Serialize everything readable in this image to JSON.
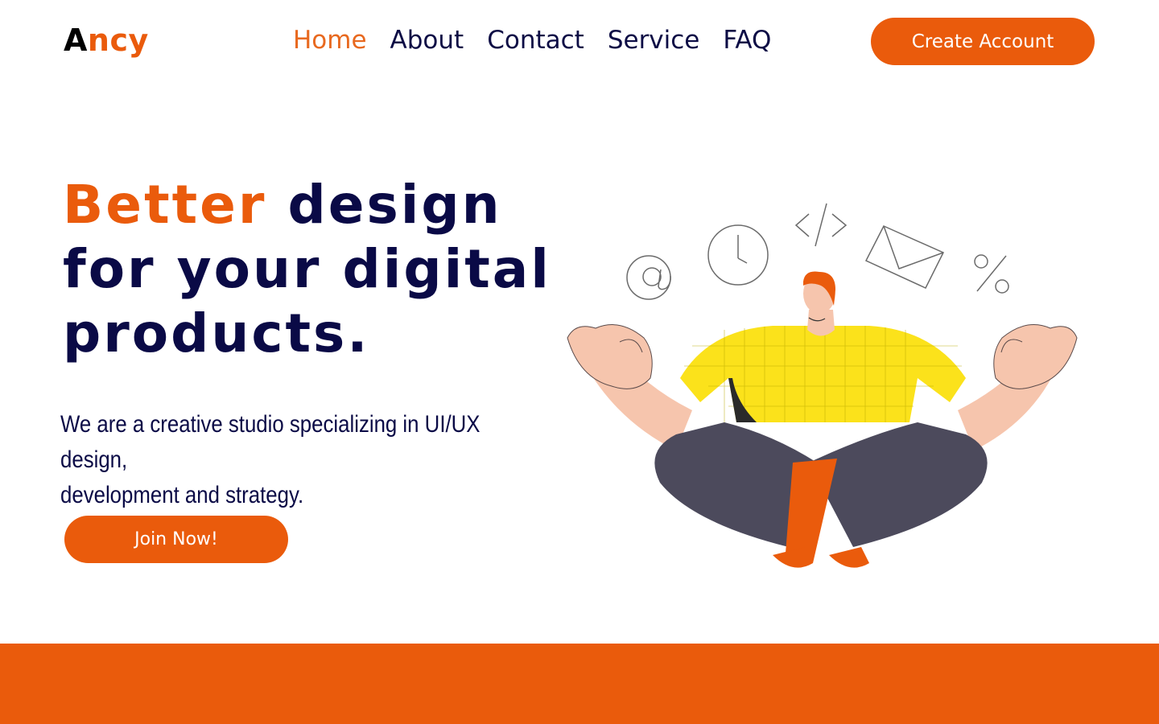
{
  "colors": {
    "accent": "#ea5b0c",
    "navy": "#0a0a46",
    "background": "#ffffff"
  },
  "brand": {
    "first": "A",
    "rest": "ncy"
  },
  "nav": {
    "items": [
      {
        "label": "Home",
        "active": true
      },
      {
        "label": "About"
      },
      {
        "label": "Contact"
      },
      {
        "label": "Service"
      },
      {
        "label": "FAQ"
      }
    ],
    "cta_label": "Create Account"
  },
  "hero": {
    "headline_highlight": "Better",
    "headline_line1_rest": "design",
    "headline_line2": "for your digital",
    "headline_line3": "products.",
    "subtitle_line1": "We are a creative studio specializing in UI/UX design,",
    "subtitle_line2": "development and strategy.",
    "cta_label": "Join Now!"
  },
  "illustration": {
    "icons": [
      "at-sign-icon",
      "clock-icon",
      "code-icon",
      "envelope-icon",
      "percent-icon"
    ]
  }
}
